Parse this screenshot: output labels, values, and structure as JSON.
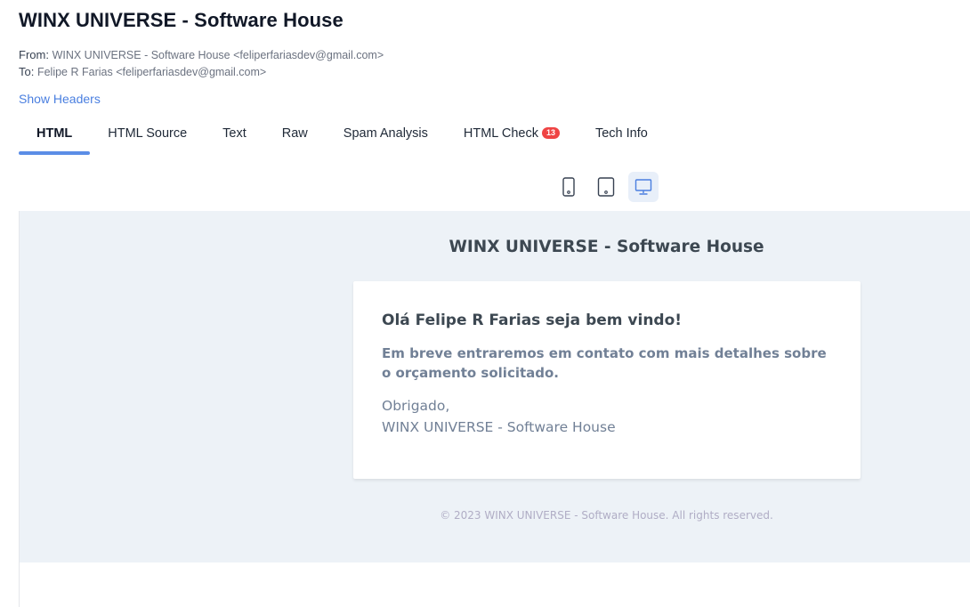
{
  "subject": "WINX UNIVERSE - Software House",
  "headers": {
    "from_label": "From:",
    "from_value": "WINX UNIVERSE - Software House <feliperfariasdev@gmail.com>",
    "to_label": "To:",
    "to_value": "Felipe R Farias <feliperfariasdev@gmail.com>",
    "show_headers": "Show Headers"
  },
  "tabs": [
    {
      "label": "HTML",
      "active": true
    },
    {
      "label": "HTML Source"
    },
    {
      "label": "Text"
    },
    {
      "label": "Raw"
    },
    {
      "label": "Spam Analysis"
    },
    {
      "label": "HTML Check",
      "badge": "13"
    },
    {
      "label": "Tech Info"
    }
  ],
  "device_toggles": [
    {
      "icon": "mobile-phone-icon"
    },
    {
      "icon": "tablet-icon"
    },
    {
      "icon": "desktop-monitor-icon",
      "active": true
    }
  ],
  "email": {
    "title": "WINX UNIVERSE - Software House",
    "greeting": "Olá Felipe R Farias seja bem vindo!",
    "lead": "Em breve entraremos em contato com mais detalhes sobre o orçamento solicitado.",
    "closing": "Obrigado,",
    "signature": "WINX UNIVERSE - Software House",
    "footer": "© 2023 WINX UNIVERSE - Software House. All rights reserved."
  },
  "colors": {
    "accent": "#5b8de6",
    "link": "#4a7fe0",
    "badge": "#ef4444",
    "email_background": "#edf2f7"
  }
}
